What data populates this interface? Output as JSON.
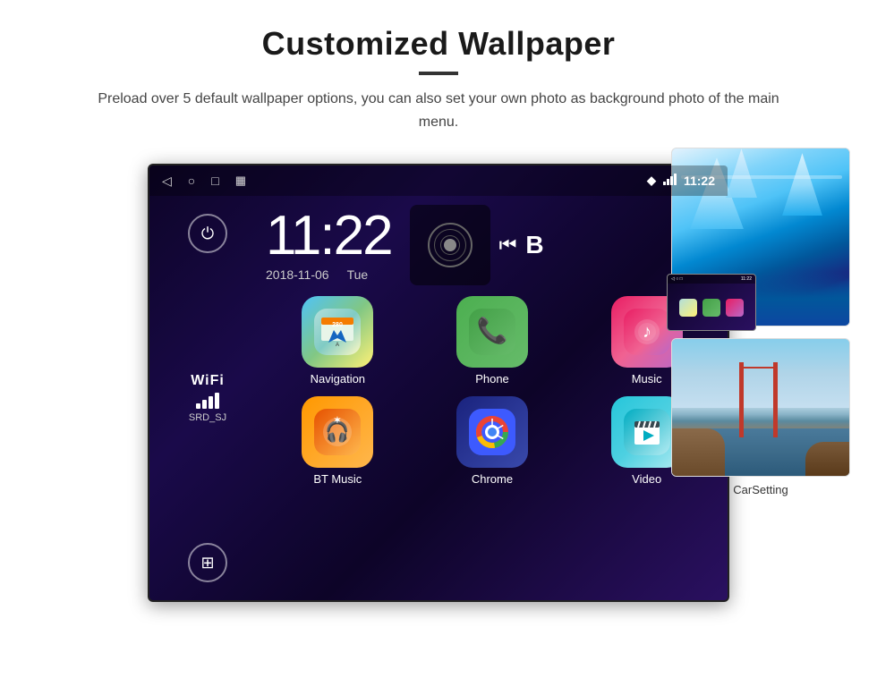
{
  "header": {
    "title": "Customized Wallpaper",
    "description": "Preload over 5 default wallpaper options, you can also set your own photo as background photo of the main menu."
  },
  "android": {
    "status_bar": {
      "nav_icons": [
        "◁",
        "○",
        "□",
        "▦"
      ],
      "time": "11:22",
      "location_icon": "📍"
    },
    "clock": {
      "time": "11:22",
      "date": "2018-11-06",
      "day": "Tue"
    },
    "wifi": {
      "label": "WiFi",
      "ssid": "SRD_SJ"
    },
    "apps": [
      {
        "label": "Navigation",
        "type": "navigation"
      },
      {
        "label": "Phone",
        "type": "phone"
      },
      {
        "label": "Music",
        "type": "music"
      },
      {
        "label": "BT Music",
        "type": "btmusic"
      },
      {
        "label": "Chrome",
        "type": "chrome"
      },
      {
        "label": "Video",
        "type": "video"
      }
    ],
    "bottom_app": {
      "label": "CarSetting",
      "type": "carsetting"
    }
  },
  "wallpapers": [
    {
      "name": "ice-cave",
      "label": "Ice Cave"
    },
    {
      "name": "golden-gate",
      "label": "Golden Gate Bridge"
    }
  ]
}
